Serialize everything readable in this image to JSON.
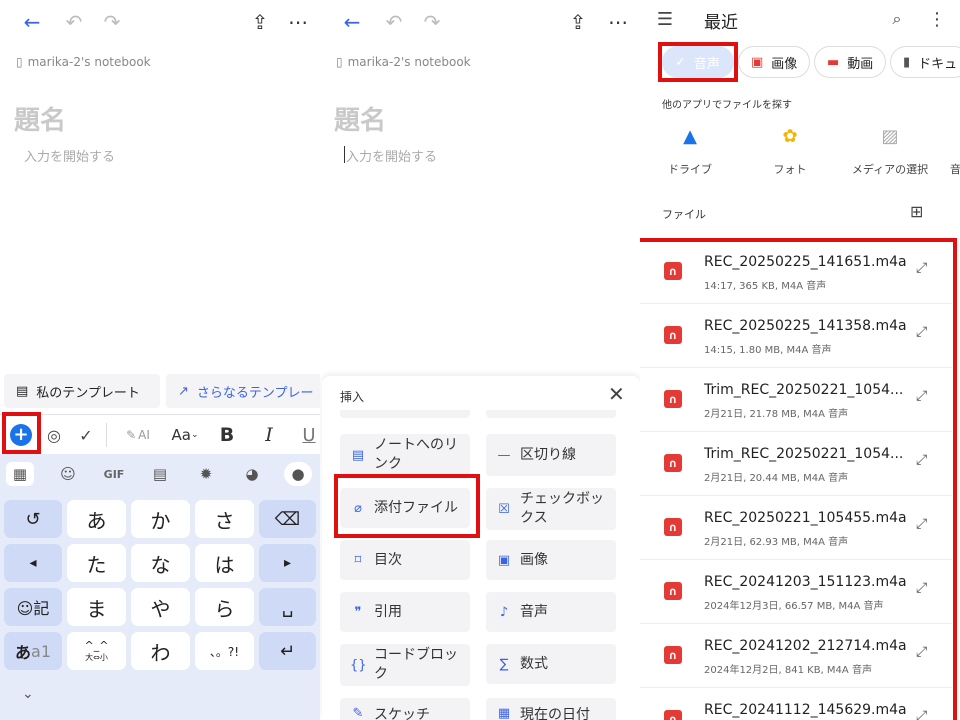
{
  "panel1": {
    "breadcrumb": "marika-2's notebook",
    "title_placeholder": "題名",
    "body_placeholder": "入力を開始する",
    "templates": {
      "mine": "私のテンプレート",
      "more": "さらなるテンプレー"
    },
    "toolbar": {
      "ai": "AI",
      "font": "Aa",
      "bold": "B",
      "italic": "I",
      "underline": "U"
    },
    "keyboard": {
      "gif": "GIF",
      "row1": [
        "↺",
        "あ",
        "か",
        "さ",
        "⌫"
      ],
      "row2": [
        "◂",
        "た",
        "な",
        "は",
        "▸"
      ],
      "row3": [
        "☺記",
        "ま",
        "や",
        "ら",
        "␣"
      ],
      "row4_key1_a": "あ",
      "row4_key1_b": "a1",
      "row4_key2": "^_^",
      "row4_key2_sub": "大⇔小",
      "row4_key3": "わ",
      "row4_key4": "、。?!",
      "row4_enter": "↵",
      "collapse": "⌄"
    }
  },
  "panel2": {
    "breadcrumb": "marika-2's notebook",
    "title_placeholder": "題名",
    "body_placeholder": "入力を開始する",
    "sheet_title": "挿入",
    "items": {
      "note_link": "ノートへのリンク",
      "divider": "区切り線",
      "attachment": "添付ファイル",
      "checkbox": "チェックボックス",
      "toc": "目次",
      "image": "画像",
      "quote": "引用",
      "audio": "音声",
      "code_block": "コードブロック",
      "math": "数式",
      "sketch": "スケッチ",
      "date": "現在の日付"
    }
  },
  "panel3": {
    "title": "最近",
    "chips": [
      "音声",
      "画像",
      "動画",
      "ドキュ"
    ],
    "other_apps_label": "他のアプリでファイルを探す",
    "apps": [
      "ドライブ",
      "フォト",
      "メディアの選択",
      "音"
    ],
    "files_label": "ファイル",
    "files": [
      {
        "name": "REC_20250225_141651.m4a",
        "meta": "14:17, 365 KB, M4A 音声"
      },
      {
        "name": "REC_20250225_141358.m4a",
        "meta": "14:15, 1.80 MB, M4A 音声"
      },
      {
        "name": "Trim_REC_20250221_1054...",
        "meta": "2月21日, 21.78 MB, M4A 音声"
      },
      {
        "name": "Trim_REC_20250221_1054...",
        "meta": "2月21日, 20.44 MB, M4A 音声"
      },
      {
        "name": "REC_20250221_105455.m4a",
        "meta": "2月21日, 62.93 MB, M4A 音声"
      },
      {
        "name": "REC_20241203_151123.m4a",
        "meta": "2024年12月3日, 66.57 MB, M4A 音声"
      },
      {
        "name": "REC_20241202_212714.m4a",
        "meta": "2024年12月2日, 841 KB, M4A 音声"
      },
      {
        "name": "REC_20241112_145629.m4a",
        "meta": ""
      }
    ]
  },
  "colors": {
    "accent": "#3b63e6",
    "highlight": "#e01010",
    "audio_icon": "#e53935",
    "keyboard_bg": "#e6ebf9"
  }
}
